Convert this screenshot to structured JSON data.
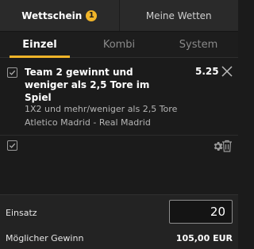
{
  "tabs": {
    "wettschein_label": "Wettschein",
    "wettschein_badge": "1",
    "meine_wetten_label": "Meine Wetten"
  },
  "subtabs": {
    "einzel": "Einzel",
    "kombi": "Kombi",
    "system": "System"
  },
  "bet": {
    "title": "Team 2 gewinnt und weniger als 2,5 Tore im Spiel",
    "odds": "5.25",
    "market": "1X2 und mehr/weniger als 2,5 Tore",
    "event": "Atletico Madrid - Real Madrid"
  },
  "stake": {
    "label": "Einsatz",
    "value": "20"
  },
  "winnings": {
    "label": "Möglicher Gewinn",
    "value": "105,00 EUR"
  },
  "colors": {
    "accent": "#f0b429",
    "background": "#1b1b1b"
  }
}
